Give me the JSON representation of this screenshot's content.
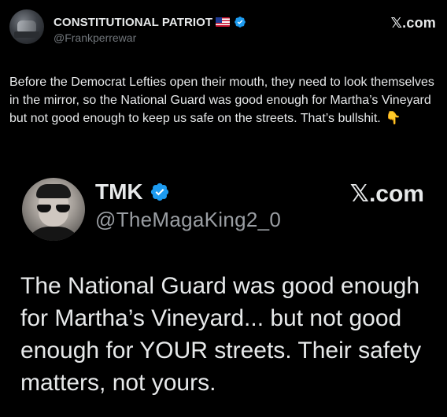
{
  "outer_post": {
    "display_name": "CONSTITUTIONAL PATRIOT",
    "handle": "@Frankperrewar",
    "flag_icon": "us-flag-icon",
    "verified_icon": "verified-badge-icon",
    "source_label": "𝕏.com",
    "text": "Before the Democrat Lefties open their mouth, they need to look themselves in the mirror, so the National Guard was good enough for Martha’s Vineyard but not good enough to keep us safe on the streets. That’s bullshit.",
    "emoji": "👇"
  },
  "embedded_post": {
    "display_name": "TMK",
    "handle": "@TheMagaKing2_0",
    "verified_icon": "verified-badge-icon",
    "source_label": "𝕏.com",
    "text": "The National Guard was good enough for Martha’s Vineyard... but not good enough for YOUR streets. Their safety matters, not yours."
  },
  "colors": {
    "background": "#000000",
    "text_primary": "#e7e9ea",
    "text_secondary": "#71767b",
    "verified_blue": "#1d9bf0"
  }
}
